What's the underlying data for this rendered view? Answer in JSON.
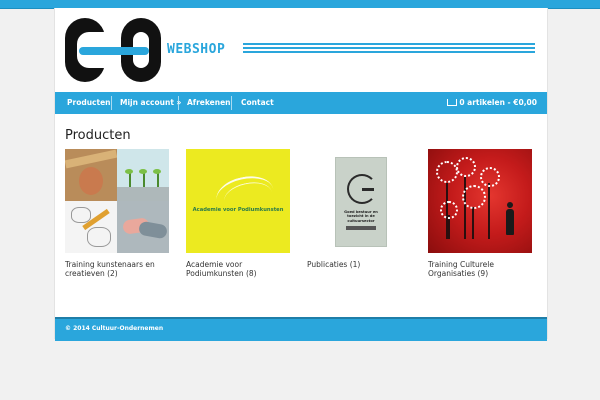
{
  "brand": {
    "webshop_label": "WEBSHOP"
  },
  "nav": {
    "items": [
      {
        "label": "Producten"
      },
      {
        "label": "Mijn account »"
      },
      {
        "label": "Afrekenen"
      },
      {
        "label": "Contact"
      }
    ],
    "cart_label": "0 artikelen - €0,00"
  },
  "page": {
    "title": "Producten"
  },
  "products": [
    {
      "name": "Training kunstenaars en creatieven",
      "count": "(2)"
    },
    {
      "name": "Academie voor Podiumkunsten",
      "count": "(8)",
      "thumb_text": "Academie voor Podiumkunsten"
    },
    {
      "name": "Publicaties",
      "count": "(1)",
      "thumb_text": "Goed bestuur en toezicht in de cultuursector"
    },
    {
      "name": "Training Culturele Organisaties",
      "count": "(9)"
    }
  ],
  "footer": {
    "text": "© 2014 Cultuur-Ondernemen"
  },
  "colors": {
    "accent": "#2aa6dc",
    "background": "#f1f1f1"
  }
}
